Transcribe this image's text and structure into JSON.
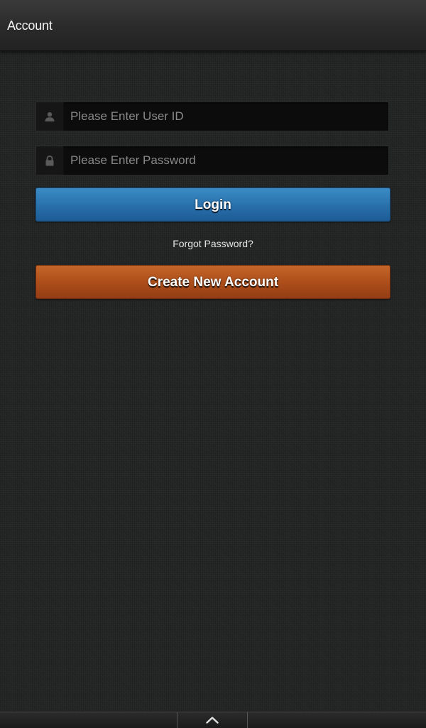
{
  "header": {
    "title": "Account"
  },
  "login_form": {
    "user_id": {
      "placeholder": "Please Enter User ID",
      "value": "",
      "icon": "user-icon"
    },
    "password": {
      "placeholder": "Please Enter Password",
      "value": "",
      "icon": "lock-icon"
    },
    "login_label": "Login",
    "forgot_label": "Forgot Password?",
    "create_label": "Create New Account"
  },
  "bottom_bar": {
    "icon": "chevron-up-icon"
  },
  "colors": {
    "login_button": "#2a72ad",
    "create_button": "#ae4f1b",
    "background": "#232524"
  }
}
